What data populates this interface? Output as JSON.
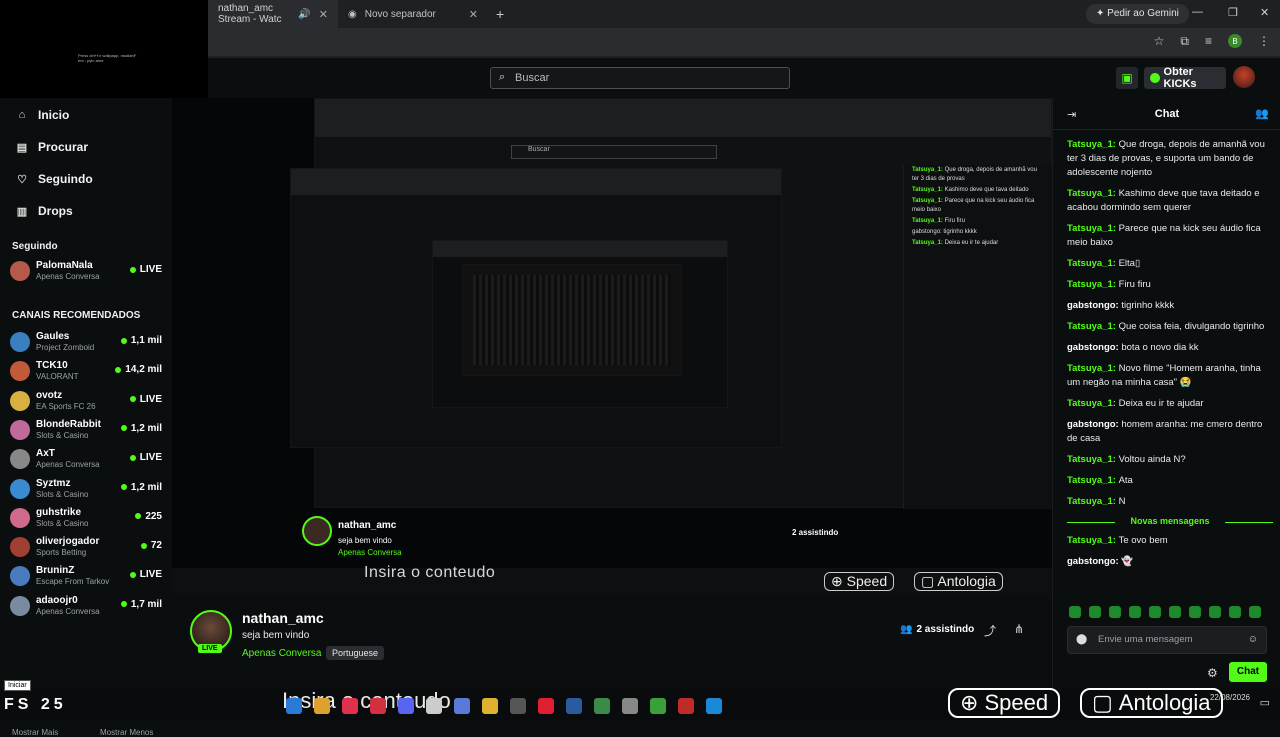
{
  "browser": {
    "tabs": [
      {
        "title": "nathan_amc Stream - Watc",
        "active": true
      },
      {
        "title": "Novo separador",
        "active": false
      }
    ],
    "new_tab": "+",
    "gemini": "Pedir ao Gemini"
  },
  "overlay": {
    "corner_text": "Press ctrl+f ir wallpapp. mudlahF ent - pylo amd"
  },
  "header": {
    "search_placeholder": "Buscar",
    "obter_label": "Obter KICKs"
  },
  "sidebar": {
    "nav": [
      {
        "label": "Inicio",
        "icon": "home-icon"
      },
      {
        "label": "Procurar",
        "icon": "browse-icon"
      },
      {
        "label": "Seguindo",
        "icon": "heart-icon"
      },
      {
        "label": "Drops",
        "icon": "drops-icon"
      }
    ],
    "following_title": "Seguindo",
    "following": [
      {
        "name": "PalomaNala",
        "category": "Apenas Conversa",
        "viewers": "LIVE",
        "color": "#b55a4a"
      }
    ],
    "recommended_title": "CANAIS RECOMENDADOS",
    "recommended": [
      {
        "name": "Gaules",
        "category": "Project Zomboid",
        "viewers": "1,1 mil",
        "color": "#3a7fc0"
      },
      {
        "name": "TCK10",
        "category": "VALORANT",
        "viewers": "14,2 mil",
        "color": "#c05a3a"
      },
      {
        "name": "ovotz",
        "category": "EA Sports FC 26",
        "viewers": "LIVE",
        "color": "#d8b040"
      },
      {
        "name": "BlondeRabbit",
        "category": "Slots & Casino",
        "viewers": "1,2 mil",
        "color": "#c06a9a"
      },
      {
        "name": "AxT",
        "category": "Apenas Conversa",
        "viewers": "LIVE",
        "color": "#888888"
      },
      {
        "name": "Syztmz",
        "category": "Slots & Casino",
        "viewers": "1,2 mil",
        "color": "#3a8ad0"
      },
      {
        "name": "guhstrike",
        "category": "Slots & Casino",
        "viewers": "225",
        "color": "#d06a8a"
      },
      {
        "name": "oliverjogador",
        "category": "Sports Betting",
        "viewers": "72",
        "color": "#a04030"
      },
      {
        "name": "BruninZ",
        "category": "Escape From Tarkov",
        "viewers": "LIVE",
        "color": "#4a7ac0"
      },
      {
        "name": "adaoojr0",
        "category": "Apenas Conversa",
        "viewers": "1,7 mil",
        "color": "#7a8aa0"
      }
    ],
    "show_more": "Mostrar Mais",
    "show_less": "Mostrar Menos"
  },
  "player": {
    "overlay_text": "Insira o conteudo",
    "speed_pill": "Speed",
    "antologia_pill": "Antologia"
  },
  "stream": {
    "name": "nathan_amc",
    "title": "seja bem vindo",
    "category": "Apenas Conversa",
    "language": "Portuguese",
    "live": "LIVE",
    "viewers": "2 assistindo"
  },
  "chat": {
    "title": "Chat",
    "messages": [
      {
        "user": "Tatsuya_1",
        "text": "Que droga, depois de amanhã vou ter 3 dias de provas, e suporta um bando de adolescente nojento",
        "color": "green"
      },
      {
        "user": "Tatsuya_1",
        "text": "Kashimo deve que tava deitado e acabou dormindo sem querer",
        "color": "green"
      },
      {
        "user": "Tatsuya_1",
        "text": "Parece que na kick seu áudio fica meio baixo",
        "color": "green"
      },
      {
        "user": "Tatsuya_1",
        "text": "Elta▯",
        "color": "green"
      },
      {
        "user": "Tatsuya_1",
        "text": "Firu firu",
        "color": "green"
      },
      {
        "user": "gabstongo",
        "text": "tigrinho kkkk",
        "color": "white"
      },
      {
        "user": "Tatsuya_1",
        "text": "Que coisa feia, divulgando tigrinho",
        "color": "green"
      },
      {
        "user": "gabstongo",
        "text": "bota o novo dia kk",
        "color": "white"
      },
      {
        "user": "Tatsuya_1",
        "text": "Novo filme \"Homem aranha, tinha um negão na minha casa\" 😭",
        "color": "green"
      },
      {
        "user": "Tatsuya_1",
        "text": "Deixa eu ir te ajudar",
        "color": "green"
      },
      {
        "user": "gabstongo",
        "text": "homem aranha: me cmero dentro de casa",
        "color": "white"
      },
      {
        "user": "Tatsuya_1",
        "text": "Voltou ainda N?",
        "color": "green"
      },
      {
        "user": "Tatsuya_1",
        "text": "Ata",
        "color": "green"
      },
      {
        "user": "Tatsuya_1",
        "text": "N",
        "color": "green"
      }
    ],
    "new_messages": "Novas mensagens",
    "after": [
      {
        "user": "Tatsuya_1",
        "text": "Te ovo bem",
        "color": "green"
      },
      {
        "user": "gabstongo",
        "text": "👻",
        "color": "white"
      }
    ],
    "input_placeholder": "Envie uma mensagem",
    "send_label": "Chat"
  },
  "os": {
    "start_label": "Iniciar",
    "left_text": "FS 25",
    "overlay_text": "Insira o conteudo",
    "speed": "Speed",
    "antologia": "Antologia",
    "date": "22/08/2026"
  },
  "colors": {
    "accent": "#53fc18",
    "bg": "#0b0e0f"
  }
}
